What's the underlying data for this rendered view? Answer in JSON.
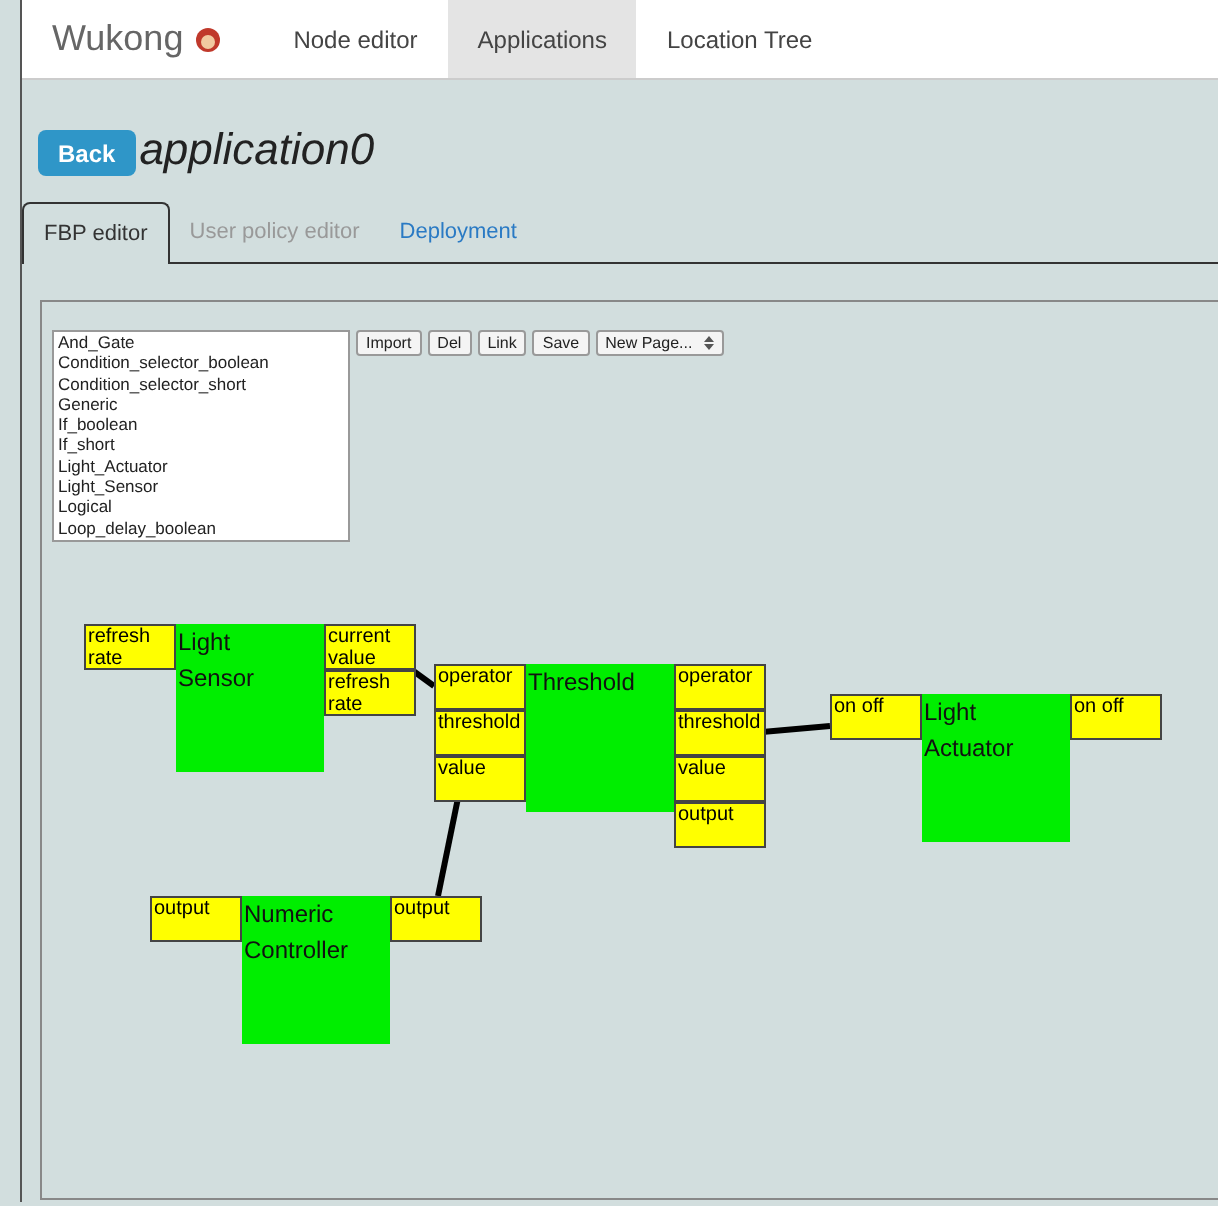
{
  "nav": {
    "brand": "Wukong",
    "items": [
      {
        "label": "Node editor",
        "selected": false
      },
      {
        "label": "Applications",
        "selected": true
      },
      {
        "label": "Location Tree",
        "selected": false
      }
    ]
  },
  "header": {
    "back": "Back",
    "title": "application0"
  },
  "tabs": [
    {
      "label": "FBP editor",
      "selected": true,
      "disabled": false
    },
    {
      "label": "User policy editor",
      "selected": false,
      "disabled": true
    },
    {
      "label": "Deployment",
      "selected": false,
      "disabled": false
    }
  ],
  "component_list": [
    "And_Gate",
    "Condition_selector_boolean",
    "Condition_selector_short",
    "Generic",
    "If_boolean",
    "If_short",
    "Light_Actuator",
    "Light_Sensor",
    "Logical",
    "Loop_delay_boolean"
  ],
  "toolbar": {
    "buttons": [
      "Import",
      "Del",
      "Link",
      "Save"
    ],
    "page_select": "New Page..."
  },
  "nodes": [
    {
      "name": "Light Sensor",
      "inputs": [
        "refresh rate"
      ],
      "outputs": [
        "current value",
        "refresh rate"
      ]
    },
    {
      "name": "Threshold",
      "inputs": [
        "operator",
        "threshold",
        "value"
      ],
      "outputs": [
        "operator",
        "threshold",
        "value",
        "output"
      ]
    },
    {
      "name": "Light Actuator",
      "inputs": [
        "on off"
      ],
      "outputs": [
        "on off"
      ]
    },
    {
      "name": "Numeric Controller",
      "inputs": [
        "output"
      ],
      "outputs": [
        "output"
      ]
    }
  ]
}
